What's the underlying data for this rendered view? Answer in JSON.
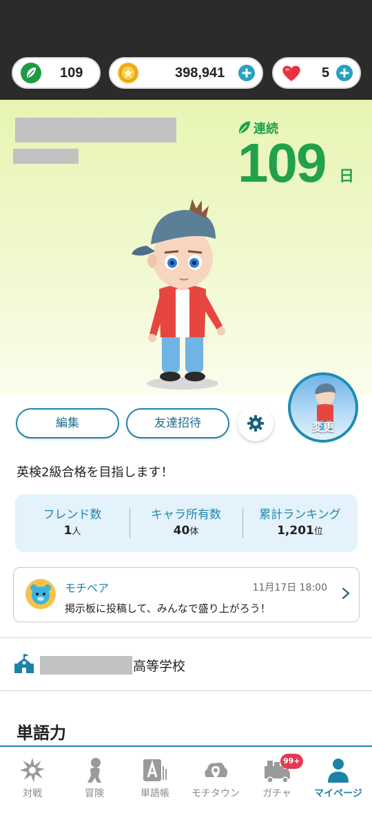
{
  "status": {
    "leaf_count": "109",
    "coins": "398,941",
    "hearts": "5"
  },
  "profile": {
    "streak_label": "連続",
    "streak_days": "109",
    "streak_unit": "日",
    "change_label": "変更",
    "edit_label": "編集",
    "invite_label": "友達招待",
    "bio": "英検2級合格を目指します！"
  },
  "stats": [
    {
      "label": "フレンド数",
      "value": "1",
      "unit": "人"
    },
    {
      "label": "キャラ所有数",
      "value": "40",
      "unit": "体"
    },
    {
      "label": "累計ランキング",
      "value": "1,201",
      "unit": "位"
    }
  ],
  "notice": {
    "name": "モチベア",
    "time": "11月17日 18:00",
    "message": "掲示板に投稿して、みんなで盛り上がろう！"
  },
  "school": {
    "suffix": "高等学校"
  },
  "section": {
    "title": "単語力"
  },
  "nav": [
    {
      "label": "対戦",
      "icon": "battle-icon"
    },
    {
      "label": "冒険",
      "icon": "adventure-icon"
    },
    {
      "label": "単語帳",
      "icon": "wordbook-icon"
    },
    {
      "label": "モチタウン",
      "icon": "town-icon"
    },
    {
      "label": "ガチャ",
      "icon": "gacha-icon",
      "badge": "99+"
    },
    {
      "label": "マイページ",
      "icon": "mypage-icon",
      "active": true
    }
  ],
  "colors": {
    "accent": "#1b83a8",
    "streak_green": "#22a14a",
    "badge_red": "#e23b52"
  }
}
